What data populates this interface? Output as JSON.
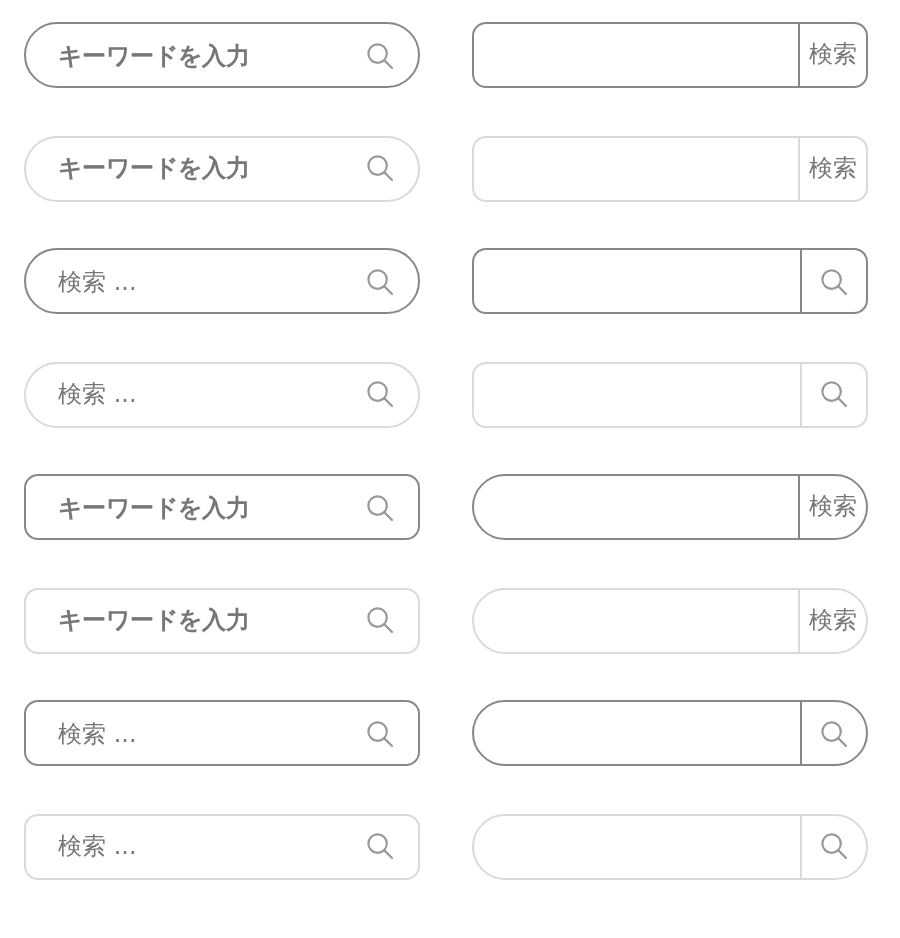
{
  "left_bars": [
    {
      "placeholder": "キーワードを入力",
      "bold": true,
      "pill": true,
      "faint": false
    },
    {
      "placeholder": "キーワードを入力",
      "bold": true,
      "pill": true,
      "faint": true
    },
    {
      "placeholder": "検索 ...",
      "bold": false,
      "pill": true,
      "faint": false
    },
    {
      "placeholder": "検索 ...",
      "bold": false,
      "pill": true,
      "faint": true
    },
    {
      "placeholder": "キーワードを入力",
      "bold": true,
      "pill": false,
      "faint": false
    },
    {
      "placeholder": "キーワードを入力",
      "bold": true,
      "pill": false,
      "faint": true
    },
    {
      "placeholder": "検索 ...",
      "bold": false,
      "pill": false,
      "faint": false
    },
    {
      "placeholder": "検索 ...",
      "bold": false,
      "pill": false,
      "faint": true
    }
  ],
  "right_bars": [
    {
      "pill": false,
      "faint": false,
      "button": {
        "kind": "text",
        "label": "検索"
      }
    },
    {
      "pill": false,
      "faint": true,
      "button": {
        "kind": "text",
        "label": "検索"
      }
    },
    {
      "pill": false,
      "faint": false,
      "button": {
        "kind": "icon"
      }
    },
    {
      "pill": false,
      "faint": true,
      "button": {
        "kind": "icon"
      }
    },
    {
      "pill": true,
      "faint": false,
      "button": {
        "kind": "text",
        "label": "検索"
      }
    },
    {
      "pill": true,
      "faint": true,
      "button": {
        "kind": "text",
        "label": "検索"
      }
    },
    {
      "pill": true,
      "faint": false,
      "button": {
        "kind": "icon"
      }
    },
    {
      "pill": true,
      "faint": true,
      "button": {
        "kind": "icon"
      }
    }
  ]
}
